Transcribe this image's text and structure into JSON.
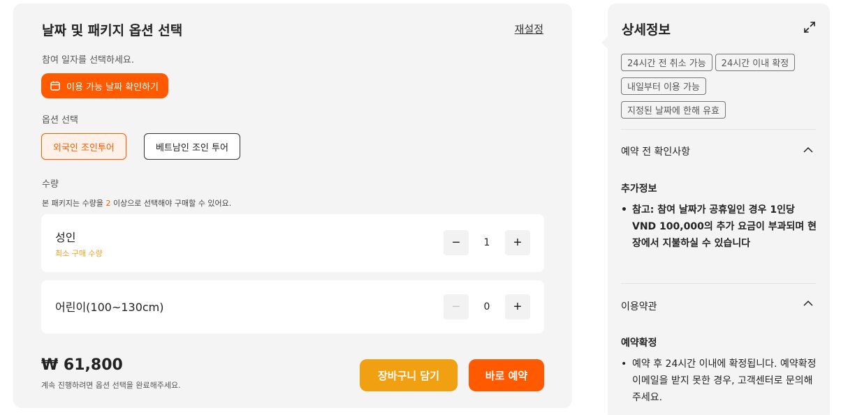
{
  "booking": {
    "title": "날짜 및 패키지 옵션 선택",
    "reset_label": "재설정",
    "date_prompt": "참여 일자를 선택하세요.",
    "date_button": "이용 가능 날짜 확인하기",
    "option_label": "옵션 선택",
    "options": [
      {
        "label": "외국인 조인투어",
        "selected": true
      },
      {
        "label": "베트남인 조인 투어",
        "selected": false
      }
    ],
    "quantity_label": "수량",
    "quantity_note_prefix": "본 패키지는 수량을 ",
    "quantity_note_min": "2",
    "quantity_note_suffix": " 이상으로 선택해야 구매할 수 있어요.",
    "rows": [
      {
        "name": "성인",
        "sub": "최소 구매 수량",
        "value": "1"
      },
      {
        "name": "어린이(100~130cm)",
        "value": "0"
      }
    ],
    "price": "₩ 61,800",
    "price_note": "계속 진행하려면 옵션 선택을 완료해주세요.",
    "cart_button": "장바구니 담기",
    "book_button": "바로 예약"
  },
  "details": {
    "title": "상세정보",
    "tags": [
      "24시간 전 취소 가능",
      "24시간 이내 확정",
      "내일부터 이용 가능",
      "지정된 날짜에 한해 유효"
    ],
    "sections": [
      {
        "heading": "예약 전 확인사항",
        "sub_heading": "추가정보",
        "text": "참고: 참여 날짜가 공휴일인 경우 1인당 VND 100,000의 추가 요금이 부과되며 현장에서 지불하실 수 있습니다"
      },
      {
        "heading": "이용약관",
        "sub_heading": "예약확정",
        "text": "예약 후 24시간 이내에 확정됩니다. 예약확정 이메일을 받지 못한 경우, 고객센터로 문의해주세요."
      }
    ]
  },
  "colors": {
    "accent": "#ff5a00",
    "secondary": "#f0a010",
    "panel": "#f4f4f4"
  }
}
